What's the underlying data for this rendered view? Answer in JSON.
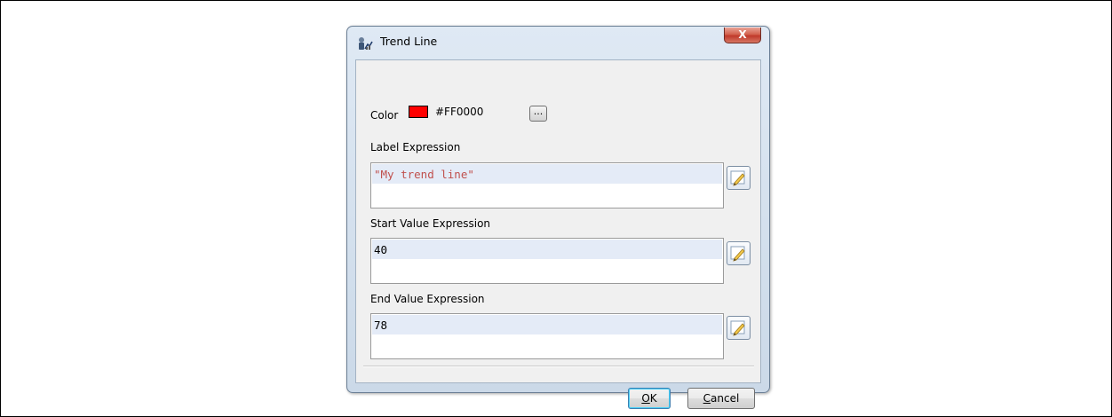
{
  "dialog": {
    "title": "Trend Line",
    "close_glyph": "X"
  },
  "color": {
    "label": "Color",
    "swatch": "#FF0000",
    "value": "#FF0000",
    "browse_label": "..."
  },
  "label_expression": {
    "label": "Label Expression",
    "value": "\"My trend line\""
  },
  "start_value_expression": {
    "label": "Start Value Expression",
    "value": "40"
  },
  "end_value_expression": {
    "label": "End Value Expression",
    "value": "78"
  },
  "buttons": {
    "ok_accel": "O",
    "ok_rest": "K",
    "cancel_accel": "C",
    "cancel_rest": "ancel"
  },
  "icons": {
    "app": "trend-line-app-icon",
    "edit": "expression-edit-icon"
  }
}
